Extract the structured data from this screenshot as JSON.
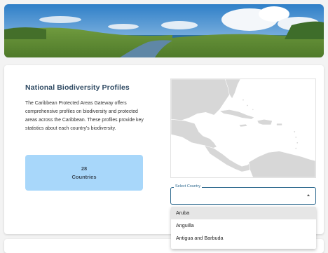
{
  "intro": {
    "title": "National Biodiversity Profiles",
    "description": "The Caribbean Protected Areas Gateway offers comprehensive profiles on biodiversity and protected areas across the Caribbean. These profiles provide key statistics about each country's biodiversity."
  },
  "stat": {
    "value": "28",
    "label": "Countries"
  },
  "country_select": {
    "label": "Select Country",
    "value": "",
    "options": [
      "Aruba",
      "Anguilla",
      "Antigua and Barbuda"
    ],
    "highlighted": "Aruba"
  },
  "colors": {
    "title": "#2f4a63",
    "stat_bg": "#a8d7fa",
    "select_border": "#2f6a8f",
    "land": "#d7d7d7"
  },
  "icons": {
    "select_caret": "caret-up-icon"
  }
}
